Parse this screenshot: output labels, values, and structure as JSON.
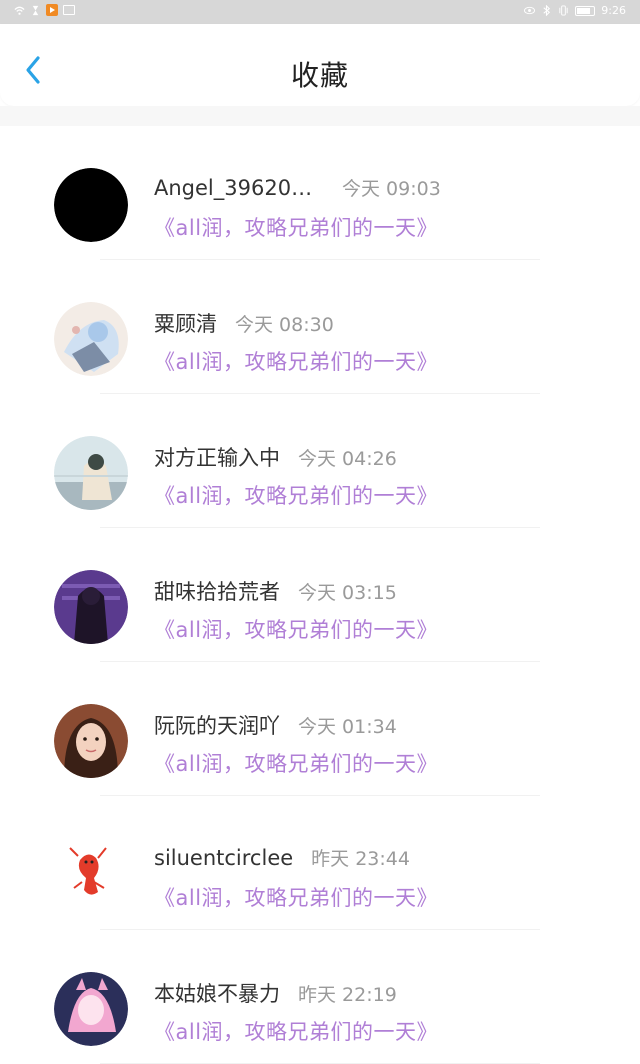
{
  "status_bar": {
    "time": "9:26",
    "battery": "100"
  },
  "header": {
    "title": "收藏"
  },
  "favorites": [
    {
      "user": "Angel_396204...",
      "time": "今天 09:03",
      "title": "《all润，攻略兄弟们的一天》"
    },
    {
      "user": "粟顾清",
      "time": "今天 08:30",
      "title": "《all润，攻略兄弟们的一天》"
    },
    {
      "user": "对方正输入中",
      "time": "今天 04:26",
      "title": "《all润，攻略兄弟们的一天》"
    },
    {
      "user": "甜味拾拾荒者",
      "time": "今天 03:15",
      "title": "《all润，攻略兄弟们的一天》"
    },
    {
      "user": "阮阮的天润吖",
      "time": "今天 01:34",
      "title": "《all润，攻略兄弟们的一天》"
    },
    {
      "user": "siluentcirclee",
      "time": "昨天 23:44",
      "title": "《all润，攻略兄弟们的一天》"
    },
    {
      "user": "本姑娘不暴力",
      "time": "昨天 22:19",
      "title": "《all润，攻略兄弟们的一天》"
    }
  ],
  "colors": {
    "accent_back": "#2aa3e6",
    "fav_title": "#b07fd6"
  }
}
